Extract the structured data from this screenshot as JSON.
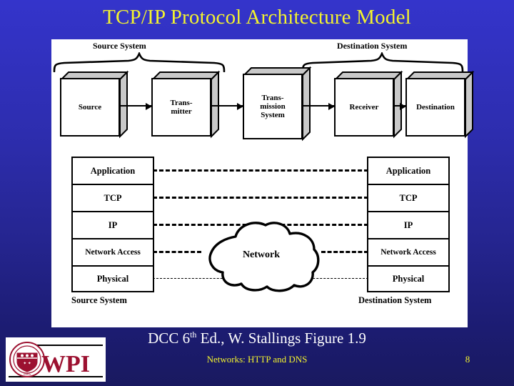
{
  "slide": {
    "title": "TCP/IP Protocol Architecture Model",
    "title_color": "#f3f32e",
    "background_top_color": "#3434cb",
    "background_bottom_color": "#19195f",
    "panel_background": "#ffffff"
  },
  "figure": {
    "top_row": {
      "source_system_label": "Source System",
      "destination_system_label": "Destination System",
      "boxes": [
        {
          "id": "source",
          "label": "Source"
        },
        {
          "id": "transmitter",
          "label_line1": "Trans-",
          "label_line2": "mitter"
        },
        {
          "id": "transmission-system",
          "label_line1": "Trans-",
          "label_line2": "mission",
          "label_line3": "System"
        },
        {
          "id": "receiver",
          "label": "Receiver"
        },
        {
          "id": "destination",
          "label": "Destination"
        }
      ]
    },
    "stacks": {
      "source": {
        "caption": "Source System",
        "layers": [
          "Application",
          "TCP",
          "IP",
          "Network Access",
          "Physical"
        ]
      },
      "destination": {
        "caption": "Destination System",
        "layers": [
          "Application",
          "TCP",
          "IP",
          "Network Access",
          "Physical"
        ]
      }
    },
    "cloud_label": "Network"
  },
  "footer": {
    "credit_prefix": "DCC 6",
    "credit_superscript": "th",
    "credit_suffix": " Ed., W. Stallings Figure 1.9",
    "subtitle": "Networks: HTTP and DNS",
    "page_number": "8",
    "text_color": "#ffffff",
    "accent_color": "#f3f32e"
  },
  "logo": {
    "wordmark": "WPI",
    "seal_ring_text": "WORCESTER POLYTECHNIC INSTITUTE",
    "seal_year": "1865",
    "brand_color": "#9c1130"
  }
}
